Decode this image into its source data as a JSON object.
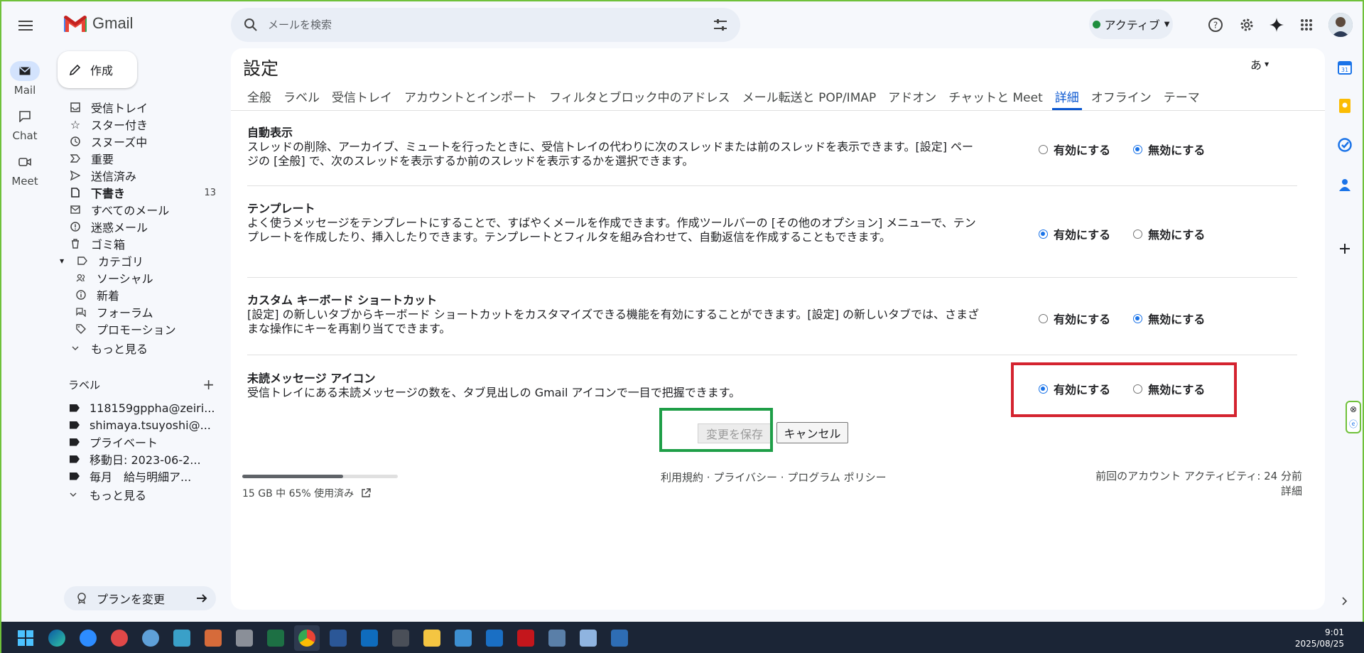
{
  "app": {
    "name": "Gmail"
  },
  "search": {
    "placeholder": "メールを検索"
  },
  "status": {
    "label": "アクティブ"
  },
  "rail": [
    {
      "label": "Mail",
      "icon": "mail-icon"
    },
    {
      "label": "Chat",
      "icon": "chat-icon"
    },
    {
      "label": "Meet",
      "icon": "meet-icon"
    }
  ],
  "compose": {
    "label": "作成"
  },
  "nav": [
    {
      "label": "受信トレイ",
      "icon": "inbox-icon"
    },
    {
      "label": "スター付き",
      "icon": "star-icon"
    },
    {
      "label": "スヌーズ中",
      "icon": "clock-icon"
    },
    {
      "label": "重要",
      "icon": "important-icon"
    },
    {
      "label": "送信済み",
      "icon": "send-icon"
    },
    {
      "label": "下書き",
      "icon": "draft-icon",
      "count": "13"
    },
    {
      "label": "すべてのメール",
      "icon": "all-mail-icon"
    },
    {
      "label": "迷惑メール",
      "icon": "spam-icon"
    },
    {
      "label": "ゴミ箱",
      "icon": "trash-icon"
    },
    {
      "label": "カテゴリ",
      "icon": "category-icon"
    },
    {
      "label": "ソーシャル",
      "icon": "social-icon"
    },
    {
      "label": "新着",
      "icon": "info-icon"
    },
    {
      "label": "フォーラム",
      "icon": "forum-icon"
    },
    {
      "label": "プロモーション",
      "icon": "tag-icon"
    },
    {
      "label": "もっと見る",
      "icon": "chevron-down-icon"
    }
  ],
  "labels": {
    "heading": "ラベル",
    "items": [
      "118159gppha@zeiri...",
      "shimaya.tsuyoshi@...",
      "プライベート",
      "移動日: 2023-06-2...",
      "毎月　給与明細ア..."
    ],
    "more": "もっと見る"
  },
  "plan": {
    "label": "プランを変更"
  },
  "settings": {
    "title": "設定",
    "lang": "あ",
    "tabs": [
      "全般",
      "ラベル",
      "受信トレイ",
      "アカウントとインポート",
      "フィルタとブロック中のアドレス",
      "メール転送と POP/IMAP",
      "アドオン",
      "チャットと Meet",
      "詳細",
      "オフライン",
      "テーマ"
    ],
    "active_tab": "詳細",
    "enable_label": "有効にする",
    "disable_label": "無効にする",
    "rows": [
      {
        "title": "自動表示",
        "desc": "スレッドの削除、アーカイブ、ミュートを行ったときに、受信トレイの代わりに次のスレッドまたは前のスレッドを表示できます。[設定] ページの [全般] で、次のスレッドを表示するか前のスレッドを表示するかを選択できます。",
        "selected": "disable"
      },
      {
        "title": "テンプレート",
        "desc": "よく使うメッセージをテンプレートにすることで、すばやくメールを作成できます。作成ツールバーの [その他のオプション] メニューで、テンプレートを作成したり、挿入したりできます。テンプレートとフィルタを組み合わせて、自動返信を作成することもできます。",
        "selected": "enable"
      },
      {
        "title": "カスタム キーボード ショートカット",
        "desc": "[設定] の新しいタブからキーボード ショートカットをカスタマイズできる機能を有効にすることができます。[設定] の新しいタブでは、さまざまな操作にキーを再割り当てできます。",
        "selected": "disable"
      },
      {
        "title": "未読メッセージ アイコン",
        "desc": "受信トレイにある未読メッセージの数を、タブ見出しの Gmail アイコンで一目で把握できます。",
        "selected": "enable"
      }
    ],
    "save_label": "変更を保存",
    "cancel_label": "キャンセル"
  },
  "footer": {
    "storage": "15 GB 中 65% 使用済み",
    "storage_used_fraction": 0.65,
    "links": "利用規約 · プライバシー · プログラム ポリシー",
    "activity": "前回のアカウント アクティビティ: 24 分前",
    "details": "詳細"
  },
  "taskbar": {
    "time": "9:01",
    "date": "2025/08/25"
  },
  "colors": {
    "accent": "#0b57d0",
    "highlight_red": "#d4232f",
    "highlight_green": "#1e9e47"
  }
}
